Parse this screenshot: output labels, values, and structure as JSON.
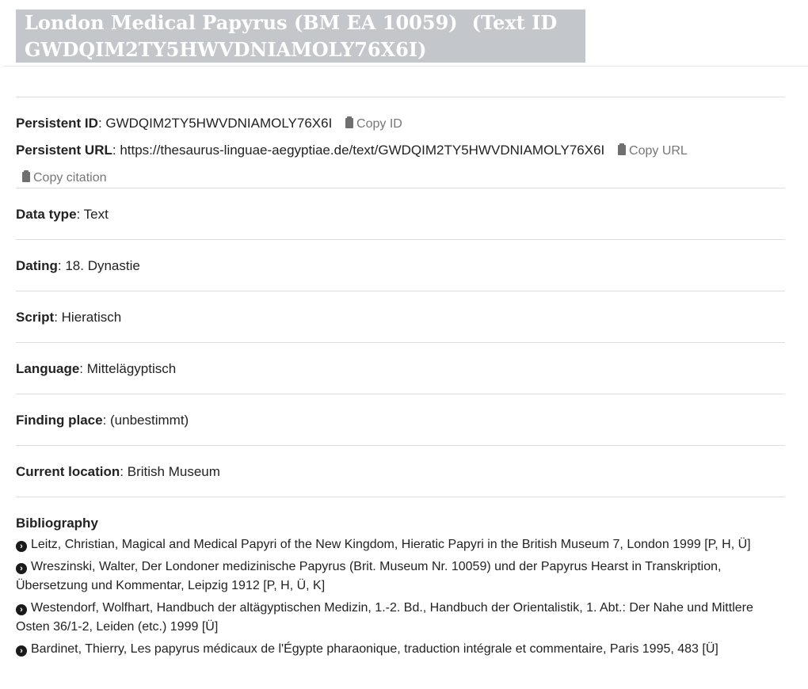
{
  "header": {
    "title": "London Medical Papyrus (BM EA 10059)",
    "text_id_label": "(Text ID GWDQIM2TY5HWVDNIAMOLY76X6I)"
  },
  "ids": {
    "persistent_id_label": "Persistent ID",
    "persistent_id": "GWDQIM2TY5HWVDNIAMOLY76X6I",
    "copy_id": "Copy ID",
    "persistent_url_label": "Persistent URL",
    "persistent_url": "https://thesaurus-linguae-aegyptiae.de/text/GWDQIM2TY5HWVDNIAMOLY76X6I",
    "copy_url": "Copy URL",
    "copy_citation": "Copy citation"
  },
  "fields": [
    {
      "label": "Data type",
      "value": "Text"
    },
    {
      "label": "Dating",
      "value": "18. Dynastie"
    },
    {
      "label": "Script",
      "value": "Hieratisch"
    },
    {
      "label": "Language",
      "value": "Mittelägyptisch"
    },
    {
      "label": "Finding place",
      "value": "(unbestimmt)"
    },
    {
      "label": "Current location",
      "value": "British Museum"
    }
  ],
  "bibliography": {
    "title": "Bibliography",
    "items": [
      "Leitz, Christian, Magical and Medical Papyri of the New Kingdom, Hieratic Papyri in the British Museum 7, London 1999 [P, H, Ü]",
      "Wreszinski, Walter, Der Londoner medizinische Papyrus (Brit. Museum Nr. 10059) und der Papyrus Hearst in Transkription, Übersetzung und Kommentar, Leipzig 1912 [P, H, Ü, K]",
      "Westendorf, Wolfhart, Handbuch der altägyptischen Medizin, 1.-2. Bd., Handbuch der Orientalistik, 1. Abt.: Der Nahe und Mittlere Osten 36/1-2, Leiden (etc.) 1999 [Ü]",
      "Bardinet, Thierry, Les papyrus médicaux de l'Égypte pharaonique, traduction intégrale et commentaire, Paris 1995, 483 [Ü]"
    ]
  },
  "icons": {
    "clipboard": "clipboard-icon",
    "arrow": "arrow-circle-right-icon"
  },
  "colors": {
    "title_bar_bg": "#c3c6cb",
    "copy_link": "#777777"
  }
}
